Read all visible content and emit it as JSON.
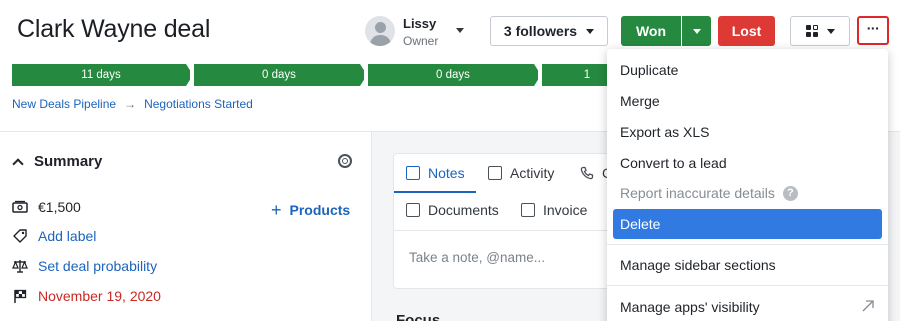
{
  "deal": {
    "title": "Clark Wayne deal"
  },
  "owner": {
    "name": "Lissy",
    "role": "Owner"
  },
  "header": {
    "followers_label": "3 followers",
    "won_label": "Won",
    "lost_label": "Lost",
    "more_label": "···"
  },
  "pipeline": {
    "stages": [
      "11 days",
      "0 days",
      "0 days",
      "1"
    ],
    "breadcrumb": [
      "New Deals Pipeline",
      "Negotiations Started"
    ],
    "breadcrumb_arrow": "→"
  },
  "summary": {
    "title": "Summary",
    "value": "€1,500",
    "products_label": "Products",
    "add_label": "Add label",
    "probability": "Set deal probability",
    "date": "November 19, 2020"
  },
  "tabs": {
    "notes": "Notes",
    "activity": "Activity",
    "call": "C",
    "documents": "Documents",
    "invoice": "Invoice"
  },
  "note": {
    "placeholder": "Take a note, @name..."
  },
  "focus": {
    "title": "Focus"
  },
  "menu": {
    "duplicate": "Duplicate",
    "merge": "Merge",
    "export": "Export as XLS",
    "convert": "Convert to a lead",
    "report": "Report inaccurate details",
    "report_help": "?",
    "delete": "Delete",
    "sidebar": "Manage sidebar sections",
    "apps": "Manage apps' visibility"
  },
  "colors": {
    "won": "#25893f",
    "lost": "#de3a35",
    "link": "#1c64bd",
    "date_overdue": "#c92924",
    "menu_active": "#317ae2",
    "highlight_border": "#e0272a"
  }
}
